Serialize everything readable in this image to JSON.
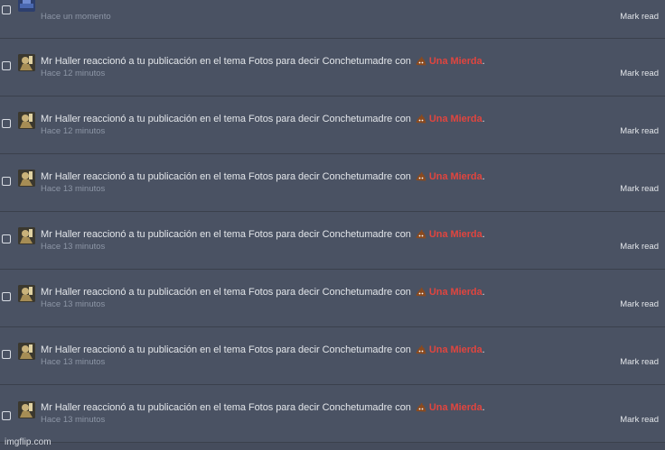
{
  "notifications": {
    "mark_read_label": "Mark read",
    "top_item": {
      "time": "Hace un momento"
    },
    "items": [
      {
        "actor": "Mr Haller",
        "text": " reaccionó a tu publicación en el tema Fotos para decir Conchetumadre con",
        "reaction": "Una Mierda",
        "suffix": ".",
        "time": "Hace 12 minutos"
      },
      {
        "actor": "Mr Haller",
        "text": " reaccionó a tu publicación en el tema Fotos para decir Conchetumadre con",
        "reaction": "Una Mierda",
        "suffix": ".",
        "time": "Hace 12 minutos"
      },
      {
        "actor": "Mr Haller",
        "text": " reaccionó a tu publicación en el tema Fotos para decir Conchetumadre con",
        "reaction": "Una Mierda",
        "suffix": ".",
        "time": "Hace 13 minutos"
      },
      {
        "actor": "Mr Haller",
        "text": " reaccionó a tu publicación en el tema Fotos para decir Conchetumadre con",
        "reaction": "Una Mierda",
        "suffix": ".",
        "time": "Hace 13 minutos"
      },
      {
        "actor": "Mr Haller",
        "text": " reaccionó a tu publicación en el tema Fotos para decir Conchetumadre con",
        "reaction": "Una Mierda",
        "suffix": ".",
        "time": "Hace 13 minutos"
      },
      {
        "actor": "Mr Haller",
        "text": " reaccionó a tu publicación en el tema Fotos para decir Conchetumadre con",
        "reaction": "Una Mierda",
        "suffix": ".",
        "time": "Hace 13 minutos"
      },
      {
        "actor": "Mr Haller",
        "text": " reaccionó a tu publicación en el tema Fotos para decir Conchetumadre con",
        "reaction": "Una Mierda",
        "suffix": ".",
        "time": "Hace 13 minutos"
      }
    ]
  },
  "icons": {
    "reaction": "poop-emoji-icon",
    "avatar": "user-avatar-icon"
  },
  "colors": {
    "background": "#454c5c",
    "row": "#4a5263",
    "reaction_text": "#e0453f",
    "time_text": "#8d96a6"
  },
  "watermark": "imgflip.com"
}
